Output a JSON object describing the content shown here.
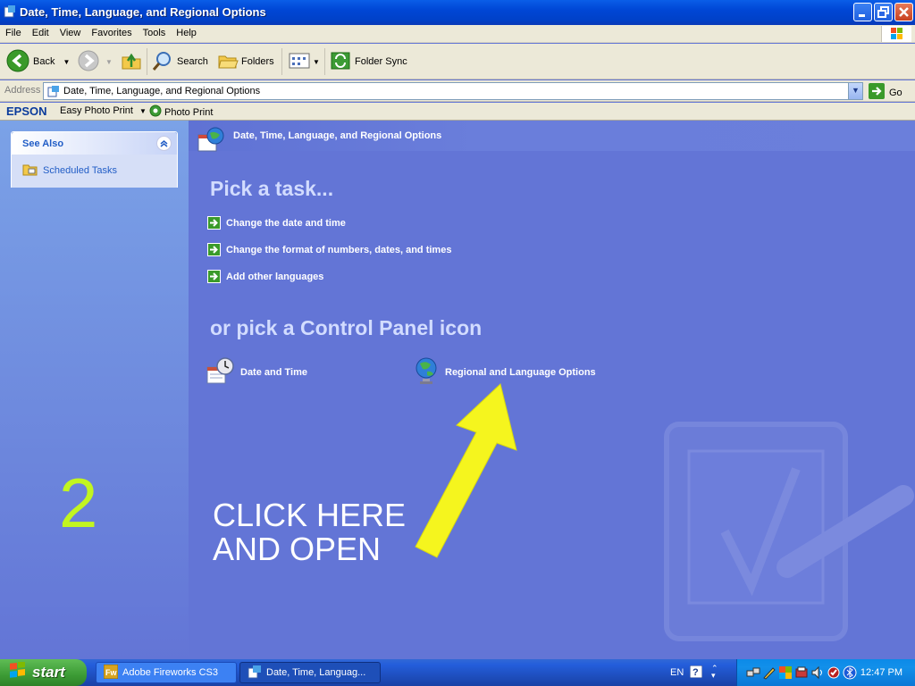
{
  "window": {
    "title": "Date, Time, Language, and Regional Options",
    "controls": [
      "minimize",
      "maximize",
      "close"
    ]
  },
  "menubar": {
    "items": [
      "File",
      "Edit",
      "View",
      "Favorites",
      "Tools",
      "Help"
    ]
  },
  "toolbar": {
    "back_label": "Back",
    "search_label": "Search",
    "folders_label": "Folders",
    "foldersync_label": "Folder Sync"
  },
  "address": {
    "label": "Address",
    "value": "Date, Time, Language, and Regional Options",
    "go_label": "Go"
  },
  "epson": {
    "brand": "EPSON",
    "easy_photo_print": "Easy Photo Print",
    "photo_print": "Photo Print"
  },
  "sidebar": {
    "see_also_title": "See Also",
    "items": [
      {
        "label": "Scheduled Tasks",
        "icon": "scheduled-tasks-icon"
      }
    ]
  },
  "main": {
    "header_title": "Date, Time, Language, and Regional Options",
    "pick_task_heading": "Pick a task...",
    "tasks": [
      "Change the date and time",
      "Change the format of numbers, dates, and times",
      "Add other languages"
    ],
    "pick_icon_heading": "or pick a Control Panel icon",
    "cp_icons": [
      {
        "label": "Date and Time",
        "icon": "date-time-icon"
      },
      {
        "label": "Regional and Language Options",
        "icon": "globe-icon"
      }
    ]
  },
  "annotation": {
    "step_number": "2",
    "instruction": "CLICK HERE\nAND OPEN",
    "arrow_color": "#f5f51e",
    "number_color": "#c2f520"
  },
  "taskbar": {
    "start_label": "start",
    "tasks": [
      {
        "label": "Adobe Fireworks CS3",
        "icon": "fireworks-icon"
      },
      {
        "label": "Date, Time, Languag...",
        "icon": "control-panel-icon"
      }
    ],
    "language": "EN",
    "clock": "12:47 PM"
  },
  "colors": {
    "xp_blue": "#0046d5",
    "panel_blue": "#6375d6",
    "taskbar_green": "#3c9b35"
  }
}
